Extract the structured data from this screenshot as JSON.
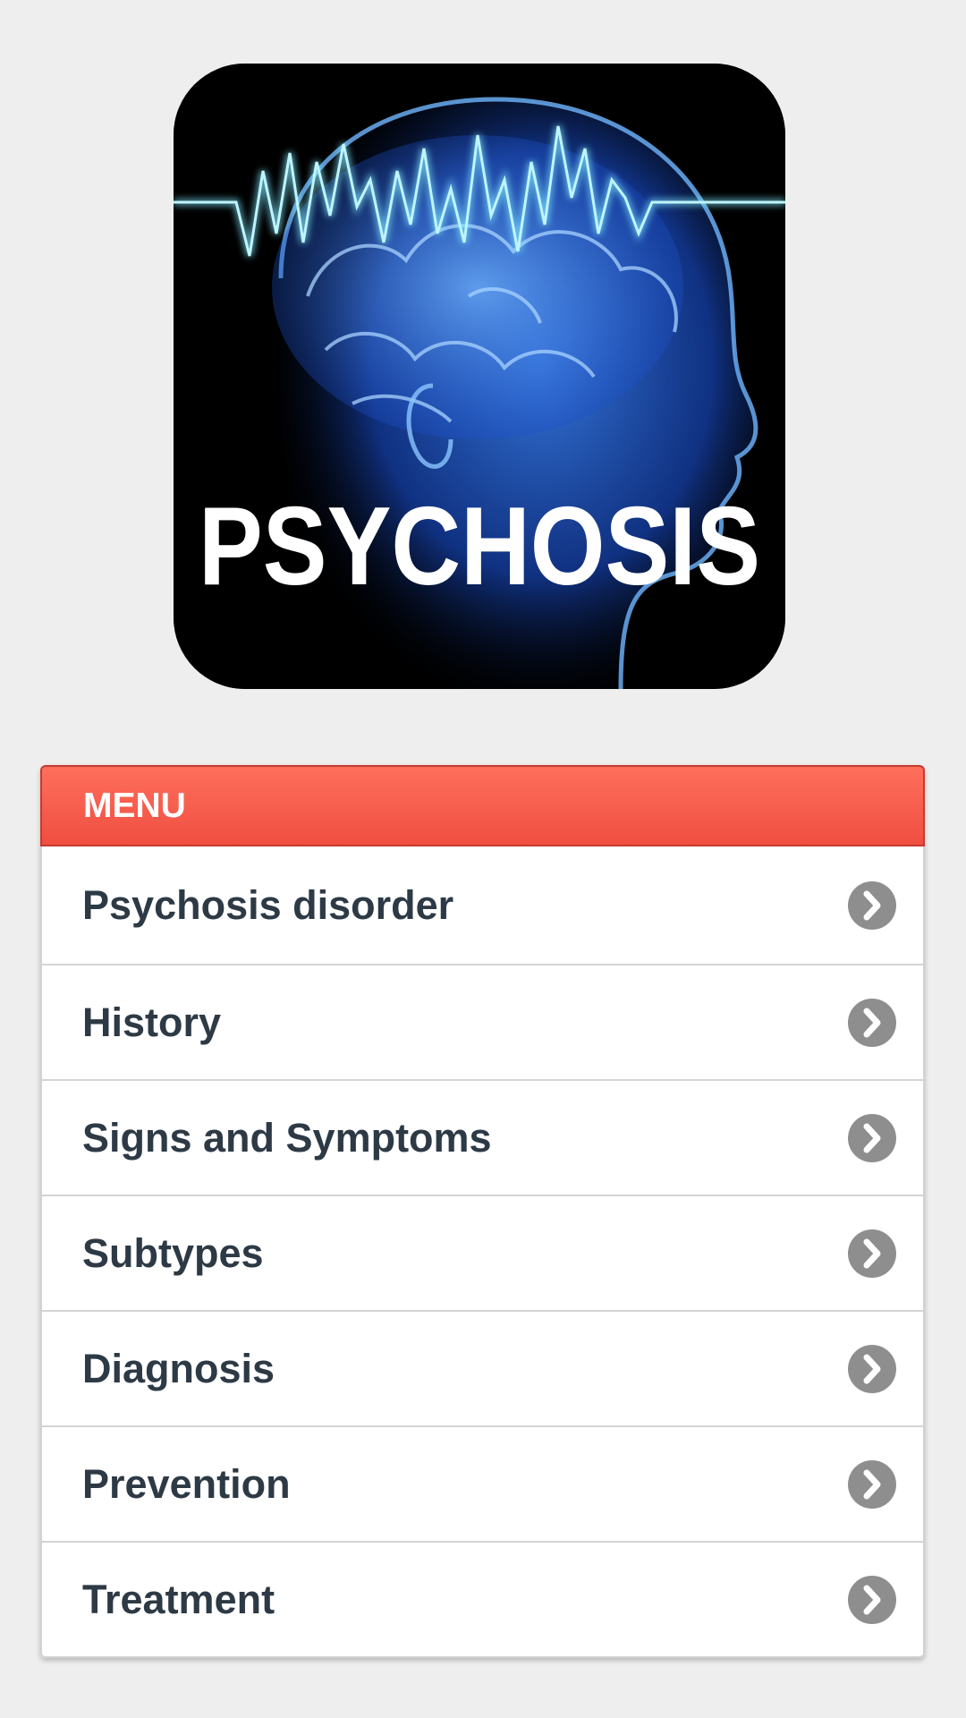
{
  "app_icon": {
    "title_text": "PSYCHOSIS",
    "icon_name": "psychosis-brain-logo",
    "colors": {
      "background": "#000000",
      "brain_blue": "#2f7dff",
      "wave_cyan": "#7fe9ff",
      "title_white": "#ffffff"
    }
  },
  "menu": {
    "header_label": "MENU",
    "header_color": "#f85a4b",
    "item_text_color": "#2d3a46",
    "item_icon": "chevron-right-circle-icon",
    "items": [
      {
        "label": "Psychosis disorder"
      },
      {
        "label": "History"
      },
      {
        "label": "Signs and Symptoms"
      },
      {
        "label": "Subtypes"
      },
      {
        "label": "Diagnosis"
      },
      {
        "label": "Prevention"
      },
      {
        "label": "Treatment"
      }
    ]
  }
}
